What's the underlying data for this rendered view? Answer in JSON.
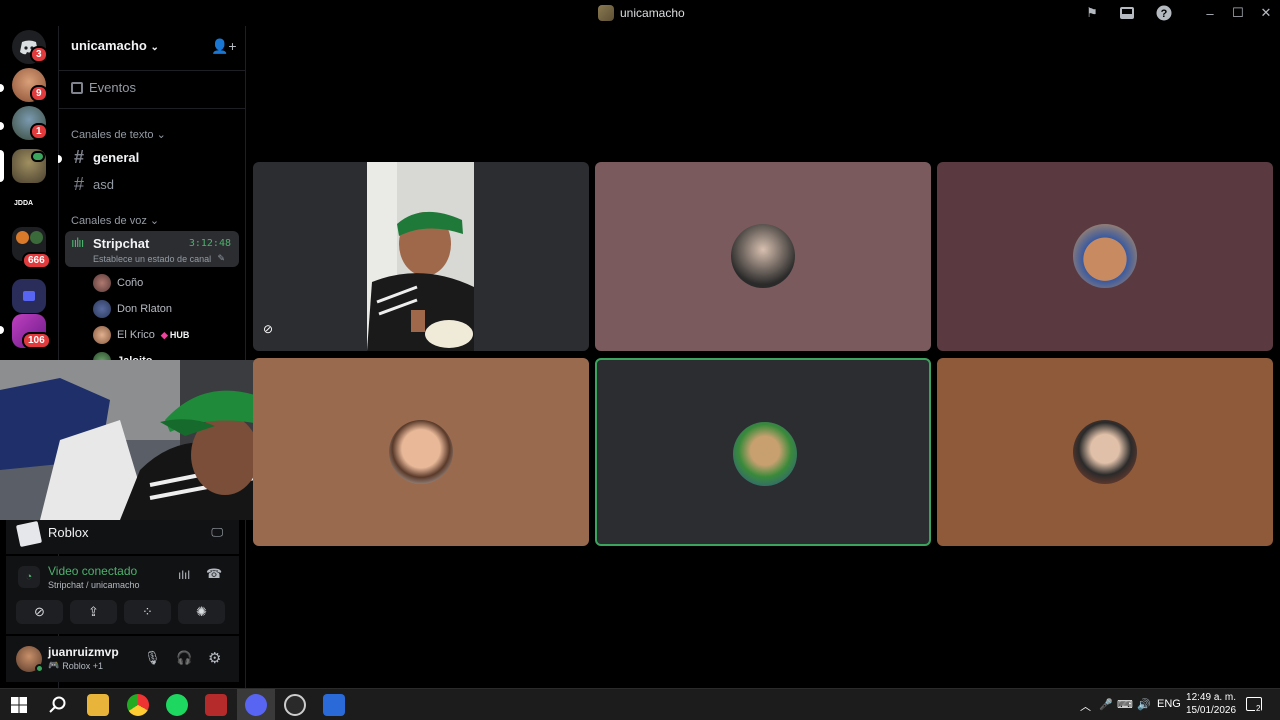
{
  "titlebar": {
    "title": "unicamacho",
    "icons": [
      "inbox-flag-icon",
      "inbox-icon",
      "help-icon",
      "minimize-icon",
      "maximize-icon",
      "close-icon"
    ]
  },
  "rail": {
    "badges": [
      "3",
      "9",
      "1",
      "666",
      "106"
    ],
    "jdda_label": "JDDA"
  },
  "sidebar": {
    "server_name": "unicamacho",
    "events_label": "Eventos",
    "text_category": "Canales de texto",
    "text_channels": [
      "general",
      "asd"
    ],
    "voice_category": "Canales de voz",
    "voice_channel": {
      "name": "Stripchat",
      "timer": "3:12:48",
      "status_placeholder": "Establece un estado de canal"
    },
    "voice_users": [
      "Coño",
      "Don Rlaton",
      "El Krico",
      "Jaloito"
    ],
    "hub_badge": "HUB"
  },
  "activity": {
    "label": "Roblox"
  },
  "rtc": {
    "status": "Video conectado",
    "location": "Stripchat / unicamacho"
  },
  "user": {
    "name": "juanruizmvp",
    "status": "Roblox +1"
  },
  "colors": {
    "tile_mauve": "#7a5a5c",
    "tile_plum": "#5a3a40",
    "tile_tan": "#9a6a4e",
    "tile_slate": "#2b2d31",
    "tile_brown": "#8e5a3a",
    "speaking": "#3ba55d",
    "connected_green": "#4fb06d"
  },
  "taskbar": {
    "lang": "ENG",
    "time": "12:49 a. m.",
    "date": "15/01/2026",
    "notif_count": "2"
  }
}
